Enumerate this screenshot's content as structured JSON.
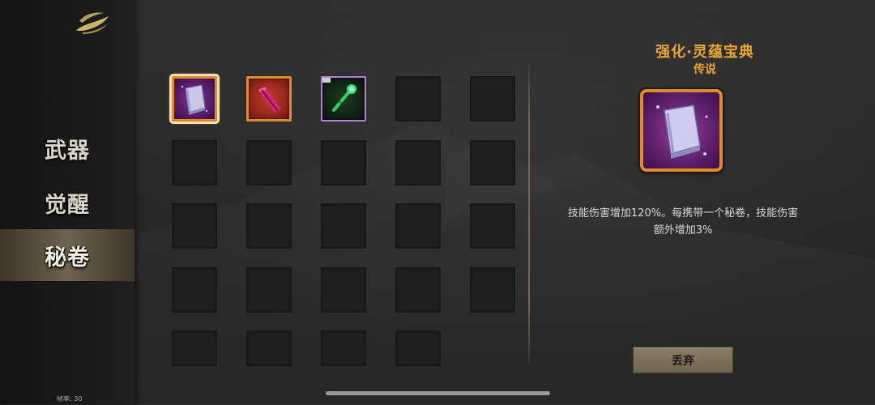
{
  "sidebar": {
    "items": [
      {
        "label": "武器",
        "active": false
      },
      {
        "label": "觉醒",
        "active": false
      },
      {
        "label": "秘卷",
        "active": true
      }
    ],
    "fps_label": "帧率: 30"
  },
  "inventory": {
    "rows": 5,
    "cols": 5,
    "items": [
      {
        "row": 0,
        "col": 0,
        "icon": "spellbook-icon",
        "rarity": "legend",
        "selected": true
      },
      {
        "row": 0,
        "col": 1,
        "icon": "red-scroll-icon",
        "rarity": "red",
        "selected": false
      },
      {
        "row": 0,
        "col": 2,
        "icon": "green-staff-icon",
        "rarity": "epic",
        "selected": false
      }
    ]
  },
  "detail": {
    "title": "强化·灵蕴宝典",
    "rarity": "传说",
    "icon": "spellbook-icon",
    "description": "技能伤害增加120%。每携带一个秘卷，技能伤害额外增加3%",
    "discard_label": "丢弃"
  },
  "colors": {
    "accent_gold": "#e8a733",
    "legend_border": "#e08a2a",
    "epic_border": "#b27ed8"
  }
}
